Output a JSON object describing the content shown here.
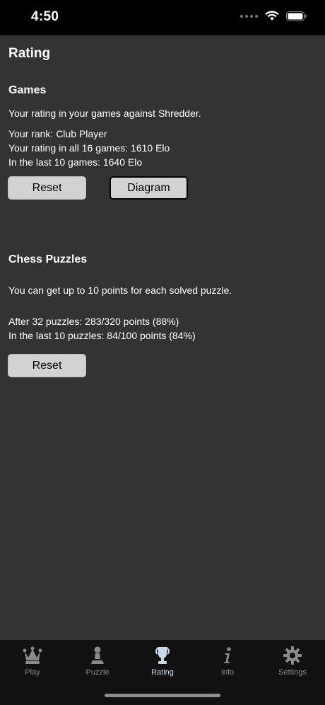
{
  "status_bar": {
    "time": "4:50"
  },
  "page": {
    "title": "Rating"
  },
  "games": {
    "title": "Games",
    "description": "Your rating in your games against Shredder.",
    "rank": "Your rank: Club Player",
    "rating_all": "Your rating in all 16 games: 1610 Elo",
    "rating_last": "In the last 10 games: 1640 Elo",
    "reset_label": "Reset",
    "diagram_label": "Diagram"
  },
  "puzzles": {
    "title": "Chess Puzzles",
    "description": "You can get up to 10 points for each solved puzzle.",
    "after": "After 32 puzzles: 283/320 points (88%)",
    "last": "In the last 10 puzzles: 84/100 points (84%)",
    "reset_label": "Reset"
  },
  "tabs": [
    {
      "label": "Play",
      "icon": "crown-icon"
    },
    {
      "label": "Puzzle",
      "icon": "pawn-icon"
    },
    {
      "label": "Rating",
      "icon": "trophy-icon",
      "active": true
    },
    {
      "label": "Info",
      "icon": "info-icon"
    },
    {
      "label": "Settings",
      "icon": "gear-icon"
    }
  ],
  "colors": {
    "background": "#333333",
    "tab_bar": "#111111",
    "button": "#d2d2d2",
    "active_tab": "#c9d8ec"
  }
}
